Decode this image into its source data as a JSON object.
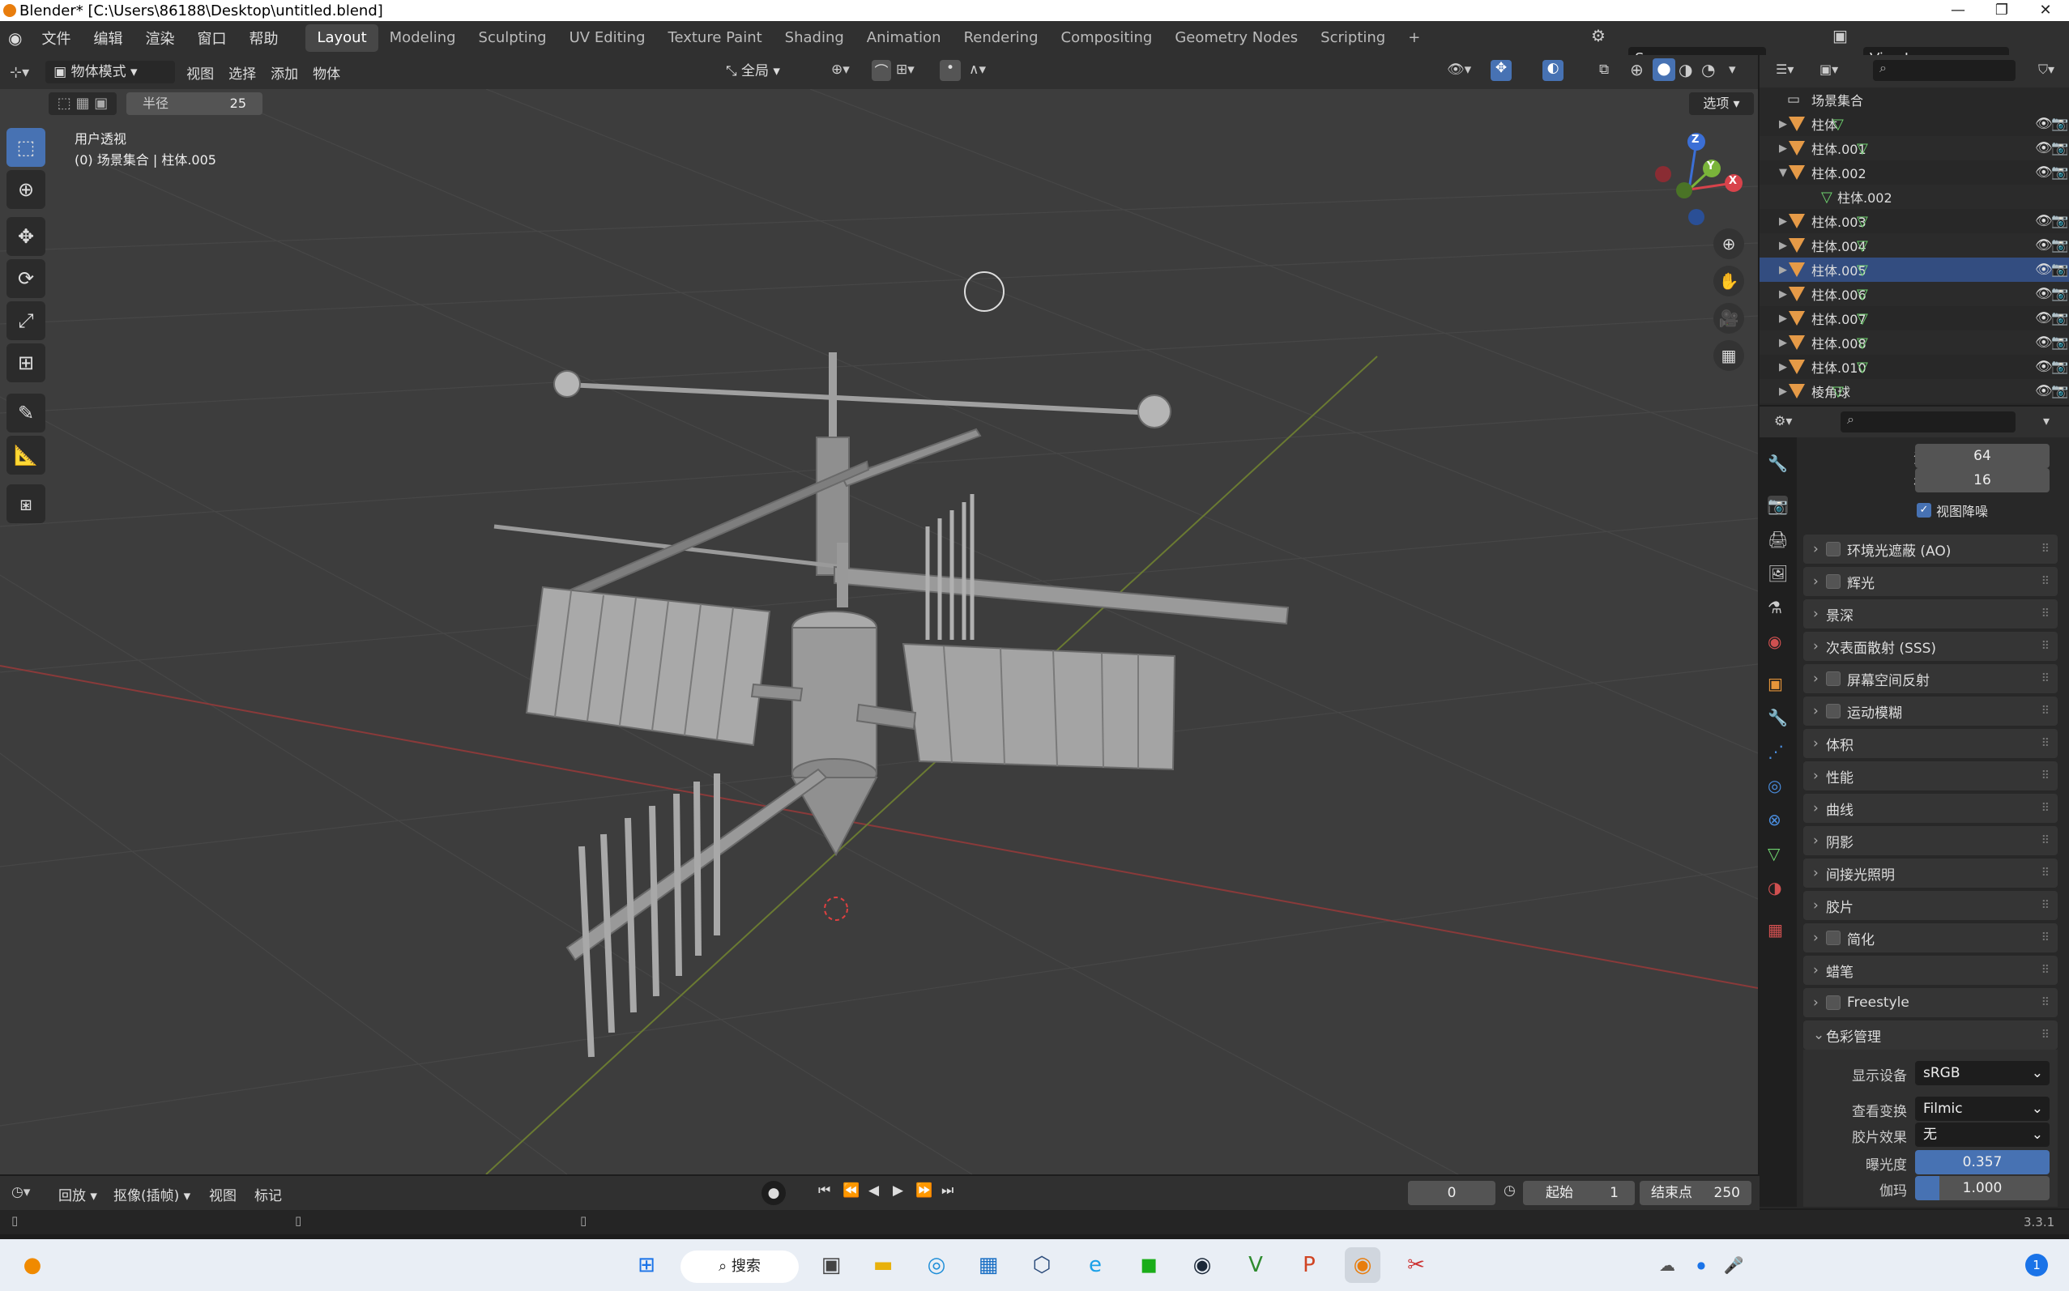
{
  "window": {
    "title": "Blender* [C:\\Users\\86188\\Desktop\\untitled.blend]",
    "minimize": "—",
    "maximize": "❐",
    "close": "✕"
  },
  "menu": [
    "文件",
    "编辑",
    "渲染",
    "窗口",
    "帮助"
  ],
  "workspaces": [
    "Layout",
    "Modeling",
    "Sculpting",
    "UV Editing",
    "Texture Paint",
    "Shading",
    "Animation",
    "Rendering",
    "Compositing",
    "Geometry Nodes",
    "Scripting",
    "+"
  ],
  "scene": "Scene",
  "view_layer": "ViewLayer",
  "viewport_header": {
    "mode": "物体模式",
    "items": [
      "视图",
      "选择",
      "添加",
      "物体"
    ],
    "transform": "全局",
    "options": "选项"
  },
  "radius": {
    "label": "半径",
    "value": "25"
  },
  "viewport_overlay": {
    "view_name": "用户透视",
    "context": "(0) 场景集合 | 柱体.005"
  },
  "gizmo": {
    "z": "Z",
    "y": "Y",
    "x": "X"
  },
  "outliner": {
    "collection": "场景集合",
    "objects": [
      {
        "name": "柱体",
        "expanded": false
      },
      {
        "name": "柱体.001",
        "expanded": false
      },
      {
        "name": "柱体.002",
        "expanded": true,
        "child": "柱体.002"
      },
      {
        "name": "柱体.003",
        "expanded": false
      },
      {
        "name": "柱体.004",
        "expanded": false
      },
      {
        "name": "柱体.005",
        "expanded": false
      },
      {
        "name": "柱体.006",
        "expanded": false
      },
      {
        "name": "柱体.007",
        "expanded": false
      },
      {
        "name": "柱体.008",
        "expanded": false
      },
      {
        "name": "柱体.010",
        "expanded": false
      },
      {
        "name": "棱角球",
        "expanded": false
      }
    ]
  },
  "properties": {
    "samples": [
      {
        "label": "渲染",
        "value": "64"
      },
      {
        "label": "视图",
        "value": "16"
      }
    ],
    "denoise": "视图降噪",
    "panels": [
      {
        "label": "环境光遮蔽 (AO)",
        "checkbox": true
      },
      {
        "label": "辉光",
        "checkbox": true
      },
      {
        "label": "景深",
        "checkbox": false
      },
      {
        "label": "次表面散射 (SSS)",
        "checkbox": false
      },
      {
        "label": "屏幕空间反射",
        "checkbox": true
      },
      {
        "label": "运动模糊",
        "checkbox": true
      },
      {
        "label": "体积",
        "checkbox": false
      },
      {
        "label": "性能",
        "checkbox": false
      },
      {
        "label": "曲线",
        "checkbox": false
      },
      {
        "label": "阴影",
        "checkbox": false
      },
      {
        "label": "间接光照明",
        "checkbox": false
      },
      {
        "label": "胶片",
        "checkbox": false
      },
      {
        "label": "简化",
        "checkbox": true
      },
      {
        "label": "蜡笔",
        "checkbox": false
      },
      {
        "label": "Freestyle",
        "checkbox": true
      }
    ],
    "color_management": {
      "label": "色彩管理",
      "display_device": {
        "label": "显示设备",
        "value": "sRGB"
      },
      "view_transform": {
        "label": "查看变换",
        "value": "Filmic"
      },
      "look": {
        "label": "胶片效果",
        "value": "无"
      },
      "exposure": {
        "label": "曝光度",
        "value": "0.357"
      },
      "gamma": {
        "label": "伽玛",
        "value": "1.000"
      }
    }
  },
  "timeline": {
    "items": [
      "回放",
      "抠像(插帧)",
      "视图",
      "标记"
    ],
    "current_frame": "0",
    "start_label": "起始",
    "start": "1",
    "end_label": "结束点",
    "end": "250"
  },
  "status": {
    "version": "3.3.1"
  },
  "taskbar": {
    "search": "搜索"
  }
}
